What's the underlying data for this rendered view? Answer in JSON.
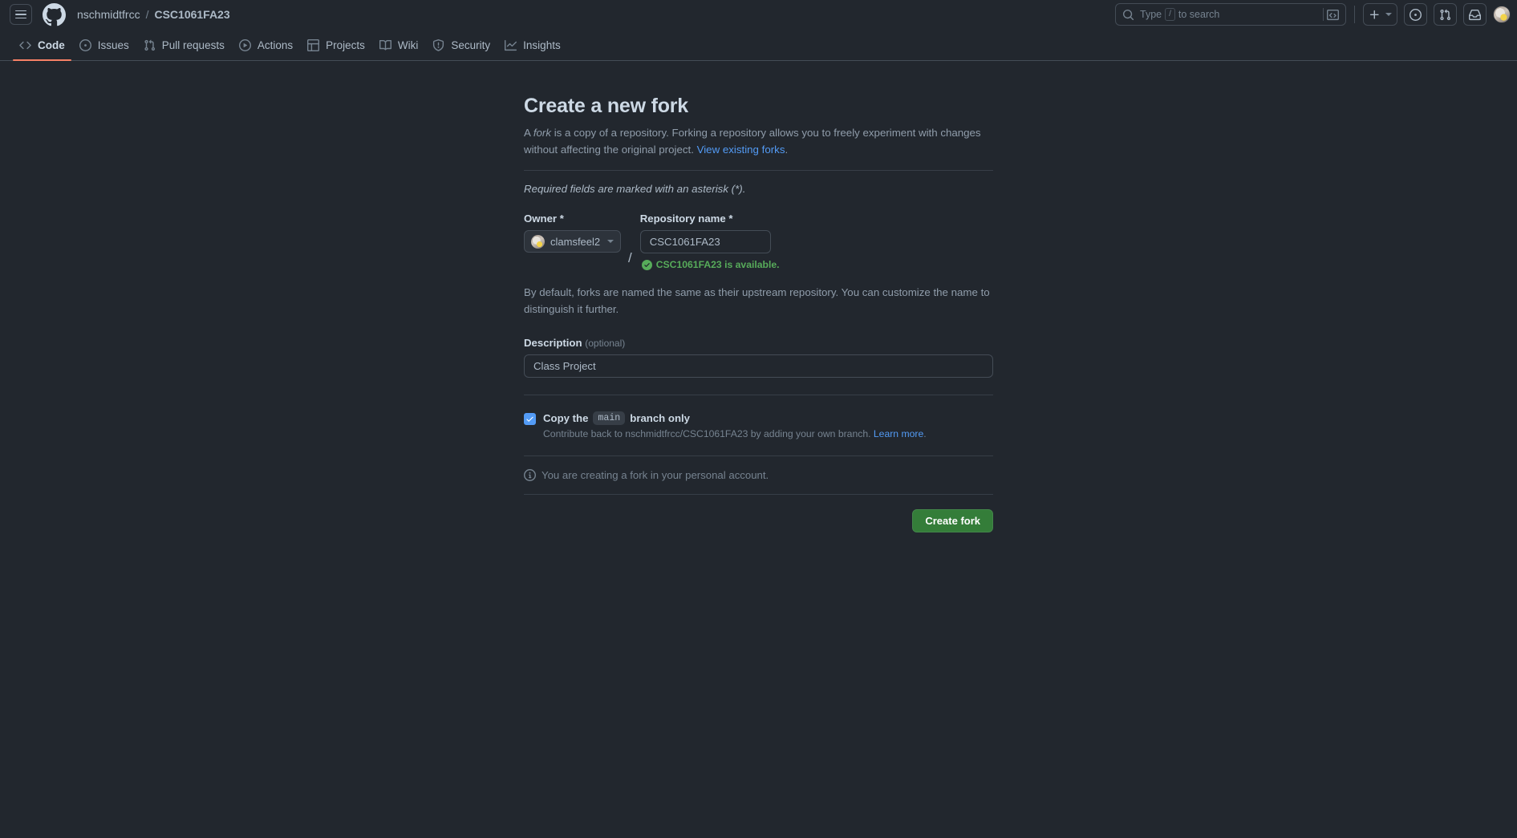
{
  "header": {
    "menu_icon": "hamburger-icon",
    "logo_icon": "github-logo-icon",
    "breadcrumb": {
      "owner": "nschmidtfrcc",
      "separator": "/",
      "repo": "CSC1061FA23"
    },
    "search": {
      "placeholder_prefix": "Type",
      "slash_key": "/",
      "placeholder_suffix": "to search",
      "value": ""
    },
    "create_new_label": "+",
    "icons": {
      "command_palette": "terminal-icon",
      "create_new": "plus-icon",
      "issues": "issue-opened-icon",
      "pull_requests": "git-pull-request-icon",
      "inbox": "inbox-icon",
      "avatar": "user-avatar"
    }
  },
  "nav": {
    "items": [
      {
        "label": "Code",
        "icon": "code-icon",
        "selected": true
      },
      {
        "label": "Issues",
        "icon": "issue-opened-icon",
        "selected": false
      },
      {
        "label": "Pull requests",
        "icon": "git-pull-request-icon",
        "selected": false
      },
      {
        "label": "Actions",
        "icon": "play-icon",
        "selected": false
      },
      {
        "label": "Projects",
        "icon": "table-icon",
        "selected": false
      },
      {
        "label": "Wiki",
        "icon": "book-icon",
        "selected": false
      },
      {
        "label": "Security",
        "icon": "shield-icon",
        "selected": false
      },
      {
        "label": "Insights",
        "icon": "graph-icon",
        "selected": false
      }
    ]
  },
  "main": {
    "title": "Create a new fork",
    "lead_part1": "A ",
    "lead_italic": "fork",
    "lead_part2": " is a copy of a repository. Forking a repository allows you to freely experiment with changes without affecting the original project. ",
    "lead_link": "View existing forks",
    "lead_period": ".",
    "required_note": "Required fields are marked with an asterisk (*).",
    "owner": {
      "label": "Owner *",
      "selected": "clamsfeel2",
      "avatar_icon": "owner-avatar-icon",
      "caret_icon": "chevron-down-icon"
    },
    "slash": "/",
    "repository": {
      "label": "Repository name *",
      "value": "CSC1061FA23",
      "availability_icon": "check-circle-icon",
      "availability_text": "CSC1061FA23 is available."
    },
    "naming_note": "By default, forks are named the same as their upstream repository. You can customize the name to distinguish it further.",
    "description": {
      "label": "Description",
      "optional": "(optional)",
      "value": "Class Project",
      "placeholder": ""
    },
    "copy_branch": {
      "checked": true,
      "label_prefix": "Copy the",
      "branch": "main",
      "label_suffix": "branch only",
      "sub_text": "Contribute back to nschmidtfrcc/CSC1061FA23 by adding your own branch.",
      "sub_link": "Learn more",
      "sub_period": "."
    },
    "personal_note": {
      "icon": "info-icon",
      "text": "You are creating a fork in your personal account."
    },
    "submit_label": "Create fork"
  },
  "colors": {
    "page_bg": "#22272e",
    "accent_blue": "#539bf5",
    "success_green": "#57ab5a",
    "button_green": "#347d39",
    "active_tab_underline": "#f78166"
  }
}
